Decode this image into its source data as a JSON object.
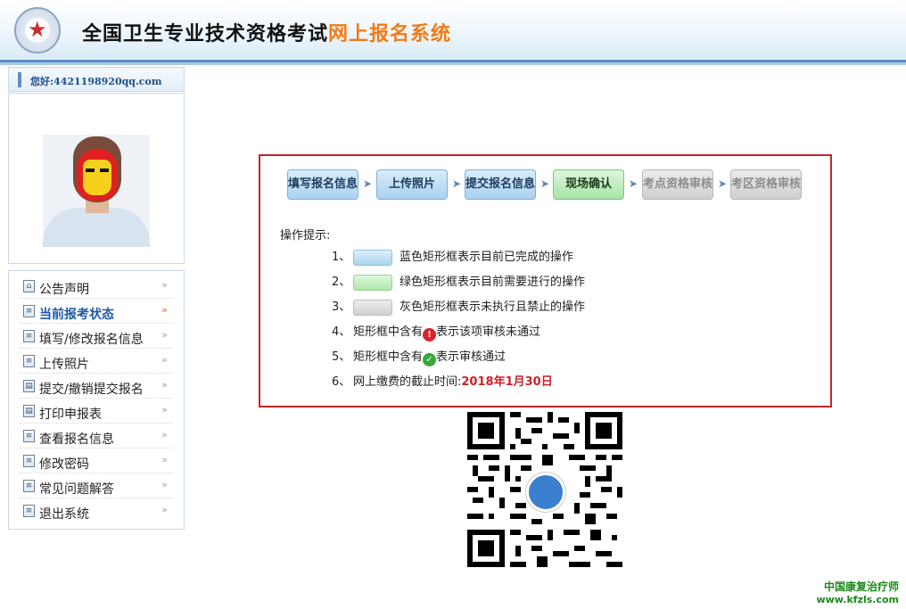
{
  "header": {
    "title_main": "全国卫生专业技术资格考试",
    "title_highlight": "网上报名系统",
    "logo_icon": "emblem-icon"
  },
  "sidebar": {
    "greeting": "您好:4421198920qq.com",
    "menu": [
      {
        "label": "公告声明",
        "icon": "home-icon",
        "active": false
      },
      {
        "label": "当前报考状态",
        "icon": "doc-icon",
        "active": true
      },
      {
        "label": "填写/修改报名信息",
        "icon": "doc-icon",
        "active": false
      },
      {
        "label": "上传照片",
        "icon": "doc-icon",
        "active": false
      },
      {
        "label": "提交/撤销提交报名",
        "icon": "page-icon",
        "active": false
      },
      {
        "label": "打印申报表",
        "icon": "page-icon",
        "active": false
      },
      {
        "label": "查看报名信息",
        "icon": "doc-icon",
        "active": false
      },
      {
        "label": "修改密码",
        "icon": "doc-icon",
        "active": false
      },
      {
        "label": "常见问题解答",
        "icon": "doc-icon",
        "active": false
      },
      {
        "label": "退出系统",
        "icon": "doc-icon",
        "active": false
      }
    ]
  },
  "steps": [
    {
      "label": "填写报名信息",
      "state": "done"
    },
    {
      "label": "上传照片",
      "state": "done"
    },
    {
      "label": "提交报名信息",
      "state": "done"
    },
    {
      "label": "现场确认",
      "state": "current"
    },
    {
      "label": "考点资格审核",
      "state": "disabled"
    },
    {
      "label": "考区资格审核",
      "state": "disabled"
    }
  ],
  "tips": {
    "title": "操作提示:",
    "items": [
      {
        "num": "1、",
        "text": "蓝色矩形框表示目前已完成的操作"
      },
      {
        "num": "2、",
        "text": "绿色矩形框表示目前需要进行的操作"
      },
      {
        "num": "3、",
        "text": "灰色矩形框表示未执行且禁止的操作"
      },
      {
        "num": "4、",
        "text_a": "矩形框中含有",
        "text_b": "表示该项审核未通过"
      },
      {
        "num": "5、",
        "text_a": "矩形框中含有",
        "text_b": "表示审核通过"
      },
      {
        "num": "6、",
        "text_a": "网上缴费的截止时间:",
        "deadline": "2018年1月30日"
      }
    ]
  },
  "watermark": {
    "line1": "中国康复治疗师",
    "line2": "www.kfzls.com"
  },
  "colors": {
    "accent_red": "#c8242a",
    "title_orange": "#f07b1c",
    "link_blue": "#1e5aa8"
  }
}
